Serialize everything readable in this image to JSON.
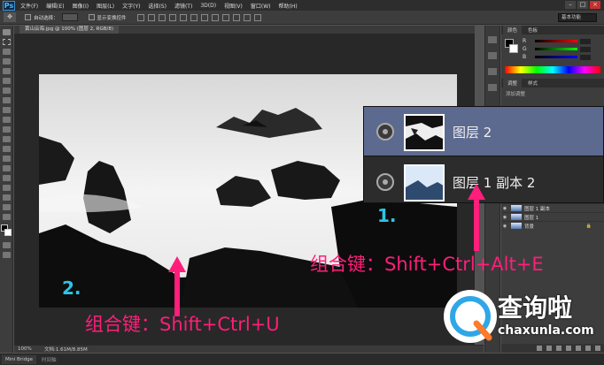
{
  "app": {
    "logo": "Ps"
  },
  "menu": [
    "文件(F)",
    "编辑(E)",
    "图像(I)",
    "图层(L)",
    "文字(Y)",
    "选择(S)",
    "滤镜(T)",
    "3D(D)",
    "视图(V)",
    "窗口(W)",
    "帮助(H)"
  ],
  "window_controls": [
    "–",
    "□",
    "×"
  ],
  "options_bar": {
    "auto_select_label": "自动选择：",
    "show_transform_label": "显示变换控件",
    "workspace": "基本功能"
  },
  "document": {
    "tab_title": "黄山云海.jpg @ 100% (图层 2, RGB/8)"
  },
  "panels": {
    "color_tabs": [
      "颜色",
      "色板"
    ],
    "color_rows": [
      "R",
      "G",
      "B"
    ],
    "adjust_tabs": [
      "调整",
      "样式"
    ],
    "adjust_hint": "添加调整",
    "mini_layers": [
      {
        "name": "图层 1 副本"
      },
      {
        "name": "图层 1"
      },
      {
        "name": "背景",
        "locked": true
      }
    ]
  },
  "zoom_layers": [
    {
      "name": "图层 2",
      "selected": true
    },
    {
      "name": "图层 1 副本 2",
      "selected": false
    }
  ],
  "annotations": {
    "step1": {
      "number": "1.",
      "text": "组合键：Shift+Ctrl+Alt+E",
      "color": "#ff1e7a"
    },
    "step2": {
      "number": "2.",
      "text": "组合键：Shift+Ctrl+U",
      "color": "#ff1e7a"
    },
    "number_color": "#2bc5e8"
  },
  "status": {
    "zoom": "100%",
    "doc": "文档:1.61M/8.85M"
  },
  "bottom_tabs": {
    "bridge": "Mini Bridge",
    "timeline": "时间轴"
  },
  "watermark": {
    "name": "查询啦",
    "domain": "chaxunla.com"
  }
}
